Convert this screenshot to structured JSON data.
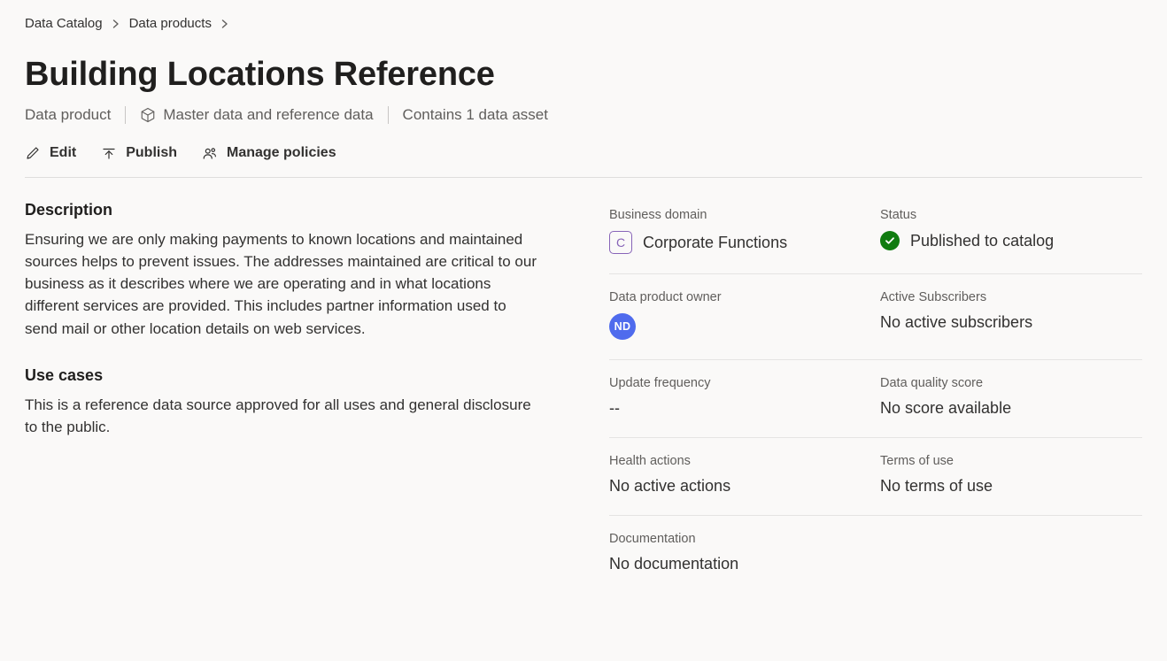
{
  "breadcrumb": {
    "item0": "Data Catalog",
    "item1": "Data products"
  },
  "header": {
    "title": "Building Locations Reference",
    "type_label": "Data product",
    "category_label": "Master data and reference data",
    "asset_count_label": "Contains 1 data asset"
  },
  "actions": {
    "edit": "Edit",
    "publish": "Publish",
    "manage_policies": "Manage policies"
  },
  "sections": {
    "description_heading": "Description",
    "description_body": "Ensuring we are only making payments to known locations and maintained sources helps to prevent issues.  The addresses maintained are critical to our business as it describes where we are operating and in what locations different services are provided.  This includes partner information used to send mail or other location details on web services.",
    "use_cases_heading": "Use cases",
    "use_cases_body": "This is a reference data source approved for all uses and general disclosure to the public."
  },
  "meta": {
    "business_domain_label": "Business domain",
    "business_domain_badge": "C",
    "business_domain_value": "Corporate Functions",
    "status_label": "Status",
    "status_value": "Published to catalog",
    "owner_label": "Data product owner",
    "owner_initials": "ND",
    "subscribers_label": "Active Subscribers",
    "subscribers_value": "No active subscribers",
    "update_freq_label": "Update frequency",
    "update_freq_value": "--",
    "dq_label": "Data quality score",
    "dq_value": "No score available",
    "health_label": "Health actions",
    "health_value": "No active actions",
    "terms_label": "Terms of use",
    "terms_value": "No terms of use",
    "documentation_label": "Documentation",
    "documentation_value": "No documentation"
  }
}
